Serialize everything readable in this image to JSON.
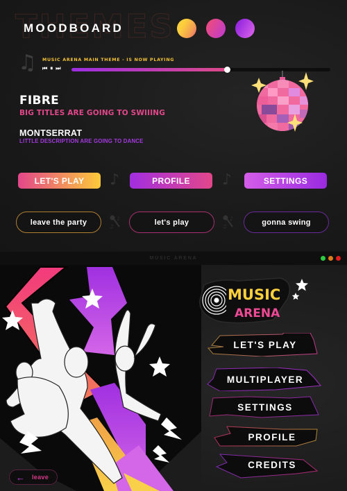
{
  "moodboard": {
    "watermark": "THEMES",
    "title": "MOODBOARD",
    "swatches": [
      {
        "name": "sunset",
        "colors": [
          "#fcd03d",
          "#e8607a"
        ]
      },
      {
        "name": "magenta",
        "colors": [
          "#e84a86",
          "#c03cc8"
        ]
      },
      {
        "name": "violet",
        "colors": [
          "#9a2ae0",
          "#d660e8"
        ]
      }
    ],
    "player": {
      "now_playing": "MUSIC ARENA MAIN THEME - IS NOW PLAYING",
      "icons": [
        "music-note-icon",
        "previous-icon",
        "pause-icon",
        "next-icon"
      ],
      "progress": 0.6
    },
    "fonts": [
      {
        "name": "FIBRE",
        "sample": "BIG TITLES ARE GOING TO SWIIING"
      },
      {
        "name": "MONTSERRAT",
        "sample": "LITTLE DESCRIPTION ARE GOING TO DANCE"
      }
    ],
    "gradient_buttons": [
      "LET'S PLAY",
      "PROFILE",
      "SETTINGS"
    ],
    "outline_buttons": [
      "leave the party",
      "let's play",
      "gonna swing"
    ]
  },
  "arena": {
    "window_title": "MUSIC ARENA",
    "window_controls": [
      {
        "name": "maximize",
        "color": "#2ecc40"
      },
      {
        "name": "minimize",
        "color": "#e07b1a"
      },
      {
        "name": "close",
        "color": "#e01e1e"
      }
    ],
    "logo": {
      "line1": "MUSIC",
      "line2": "ARENA"
    },
    "menu": [
      "LET'S PLAY",
      "MULTIPLAYER",
      "SETTINGS",
      "PROFILE",
      "CREDITS"
    ],
    "leave_label": "leave"
  },
  "colors": {
    "yellow": "#fcc93a",
    "pink": "#e2478a",
    "purple": "#a22ee0",
    "lilac": "#d660e8",
    "background": "#1a1a1a"
  }
}
